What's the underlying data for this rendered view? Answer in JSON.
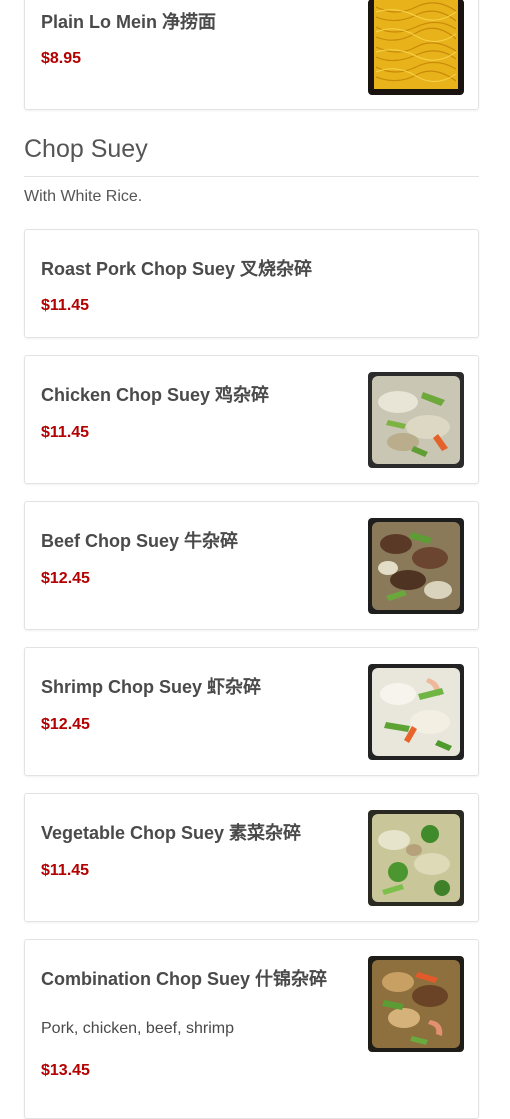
{
  "top_item": {
    "name": "Plain Lo Mein 净捞面",
    "price": "$8.95"
  },
  "section": {
    "title": "Chop Suey",
    "description": "With White Rice."
  },
  "items": [
    {
      "name": "Roast Pork Chop Suey 叉烧杂碎",
      "price": "$11.45"
    },
    {
      "name": "Chicken Chop Suey 鸡杂碎",
      "price": "$11.45"
    },
    {
      "name": "Beef Chop Suey 牛杂碎",
      "price": "$12.45"
    },
    {
      "name": "Shrimp Chop Suey 虾杂碎",
      "price": "$12.45"
    },
    {
      "name": "Vegetable Chop Suey 素菜杂碎",
      "price": "$11.45"
    },
    {
      "name": "Combination Chop Suey 什锦杂碎",
      "description": "Pork, chicken, beef, shrimp",
      "price": "$13.45"
    }
  ],
  "colors": {
    "price": "#b30000",
    "card_border": "#e3e3e3",
    "text": "#4a4a4a"
  },
  "icons": {
    "food_photo": "food-photo-icon"
  }
}
